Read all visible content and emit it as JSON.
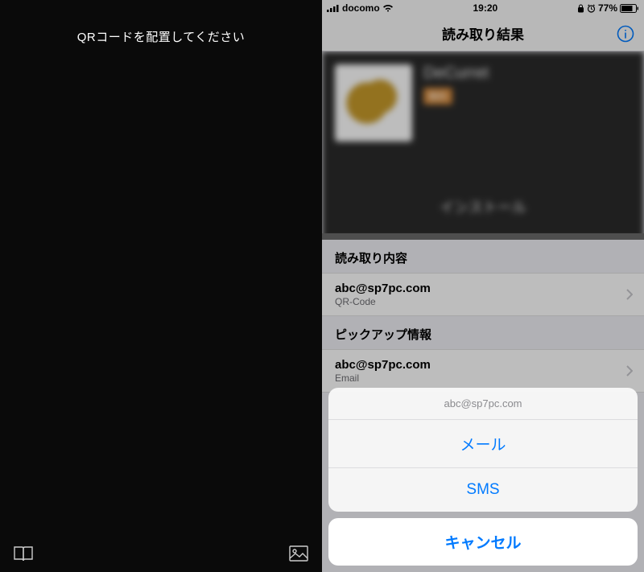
{
  "left": {
    "prompt": "QRコードを配置してください",
    "icons": {
      "history": "book-icon",
      "gallery": "image-icon"
    }
  },
  "right": {
    "statusbar": {
      "carrier": "docomo",
      "time": "19:20",
      "battery": "77%"
    },
    "nav": {
      "title": "読み取り結果"
    },
    "banner": {
      "app_name": "DeCurret",
      "badge": "無料",
      "install": "インストール"
    },
    "sections": {
      "content_header": "読み取り内容",
      "content_value": "abc@sp7pc.com",
      "content_type": "QR-Code",
      "pickup_header": "ピックアップ情報",
      "pickup_value": "abc@sp7pc.com",
      "pickup_type": "Email"
    },
    "actionsheet": {
      "title": "abc@sp7pc.com",
      "mail": "メール",
      "sms": "SMS",
      "cancel": "キャンセル"
    }
  }
}
